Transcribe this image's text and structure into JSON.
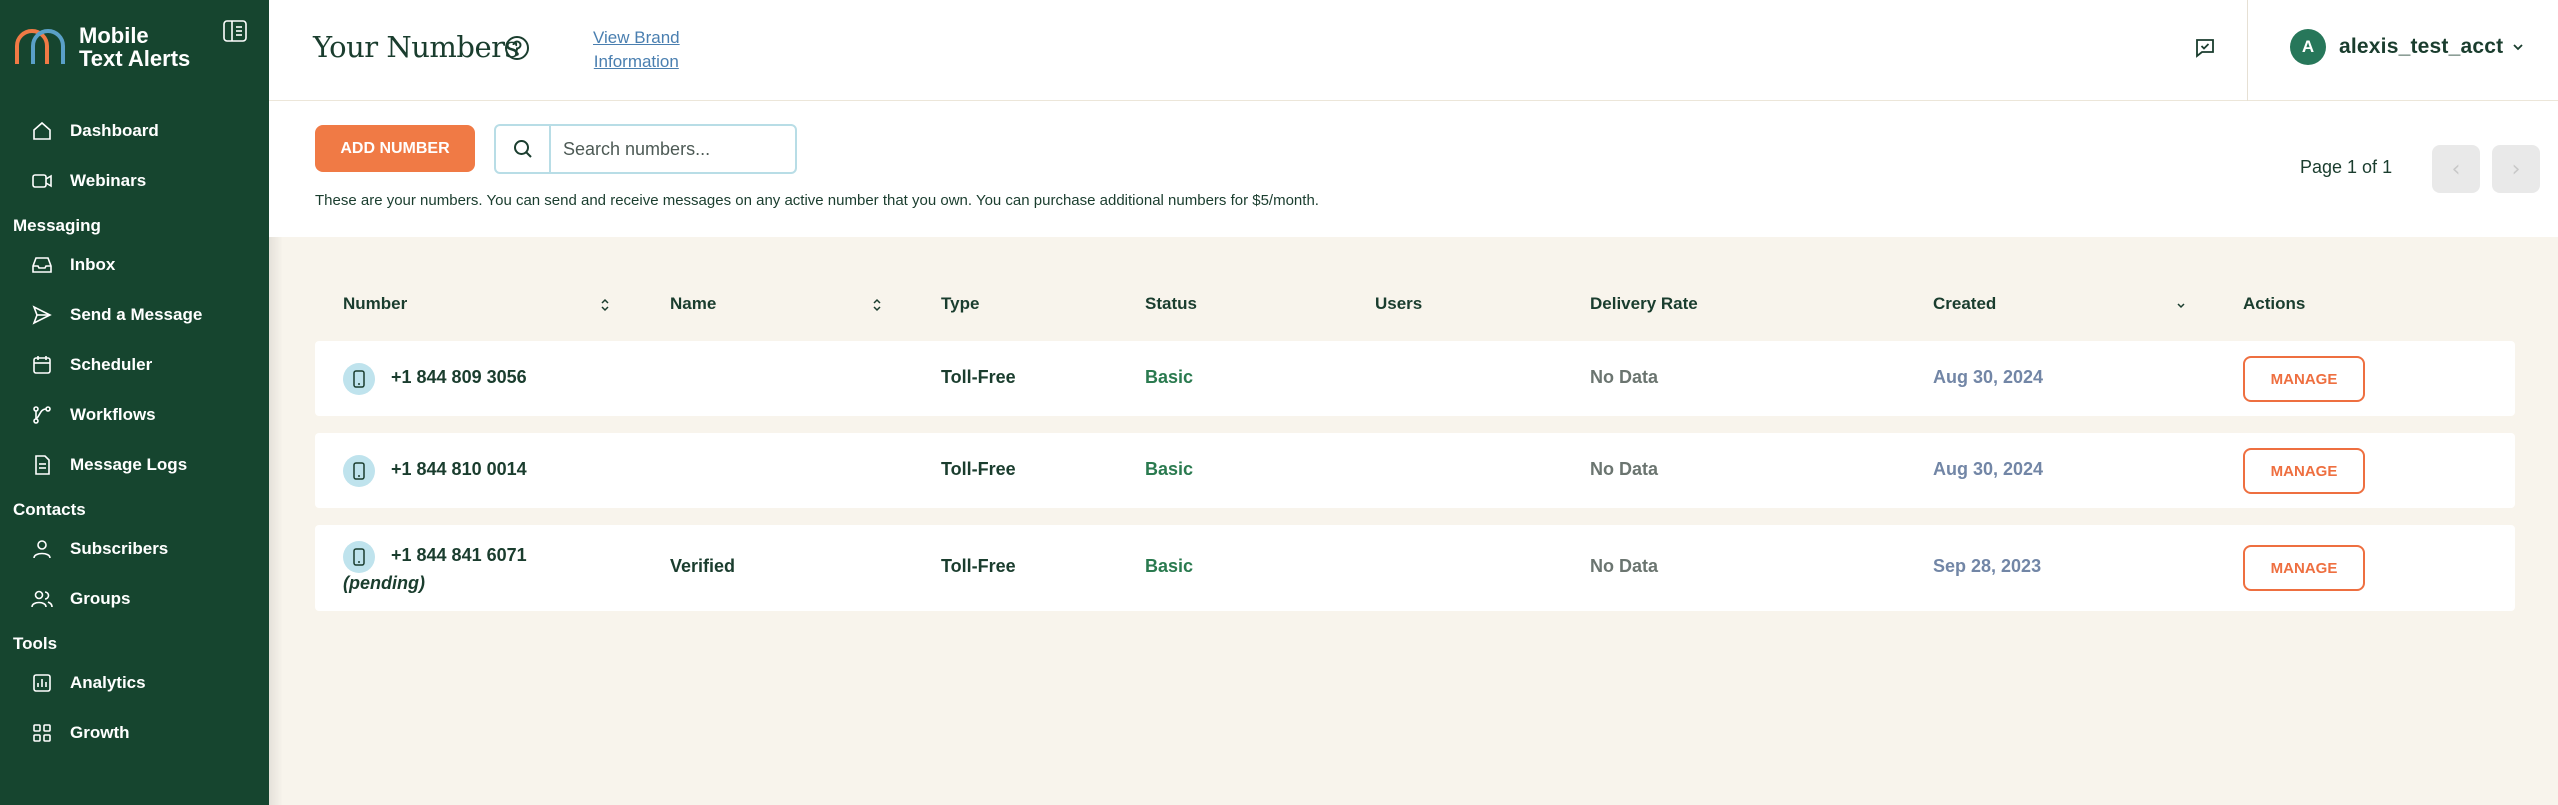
{
  "brand": {
    "name_line1": "Mobile",
    "name_line2": "Text Alerts",
    "colors": {
      "orange": "#f07a45",
      "blue": "#5aa0c8",
      "sidebar": "#16452f"
    }
  },
  "sidebar": {
    "items_top": [
      {
        "label": "Dashboard",
        "icon": "home-icon"
      },
      {
        "label": "Webinars",
        "icon": "video-icon"
      }
    ],
    "sections": [
      {
        "title": "Messaging",
        "items": [
          {
            "label": "Inbox",
            "icon": "inbox-icon"
          },
          {
            "label": "Send a Message",
            "icon": "send-icon"
          },
          {
            "label": "Scheduler",
            "icon": "calendar-icon"
          },
          {
            "label": "Workflows",
            "icon": "workflow-icon"
          },
          {
            "label": "Message Logs",
            "icon": "logs-icon"
          }
        ]
      },
      {
        "title": "Contacts",
        "items": [
          {
            "label": "Subscribers",
            "icon": "user-icon"
          },
          {
            "label": "Groups",
            "icon": "group-icon"
          }
        ]
      },
      {
        "title": "Tools",
        "items": [
          {
            "label": "Analytics",
            "icon": "analytics-icon"
          },
          {
            "label": "Growth",
            "icon": "growth-icon"
          }
        ]
      }
    ]
  },
  "header": {
    "title": "Your Numbers",
    "brand_link_line1": "View Brand",
    "brand_link_line2": "Information",
    "avatar_letter": "A",
    "account_name": "alexis_test_acct"
  },
  "toolbar": {
    "add_label": "ADD NUMBER",
    "search_placeholder": "Search numbers...",
    "info": "These are your numbers. You can send and receive messages on any active number that you own. You can purchase additional numbers for $5/month.",
    "page_text": "Page 1 of 1",
    "prev_glyph": "‹",
    "next_glyph": "›"
  },
  "table": {
    "columns": [
      "Number",
      "Name",
      "Type",
      "Status",
      "Users",
      "Delivery Rate",
      "Created",
      "Actions"
    ],
    "rows": [
      {
        "number": "+1 844 809 3056",
        "pending": "",
        "name": "",
        "type": "Toll-Free",
        "status": "Basic",
        "users": "",
        "delivery": "No Data",
        "created": "Aug 30, 2024",
        "action": "MANAGE"
      },
      {
        "number": "+1 844 810 0014",
        "pending": "",
        "name": "",
        "type": "Toll-Free",
        "status": "Basic",
        "users": "",
        "delivery": "No Data",
        "created": "Aug 30, 2024",
        "action": "MANAGE"
      },
      {
        "number": "+1 844 841 6071",
        "pending": "(pending)",
        "name": "Verified",
        "type": "Toll-Free",
        "status": "Basic",
        "users": "",
        "delivery": "No Data",
        "created": "Sep 28, 2023",
        "action": "MANAGE"
      }
    ]
  }
}
